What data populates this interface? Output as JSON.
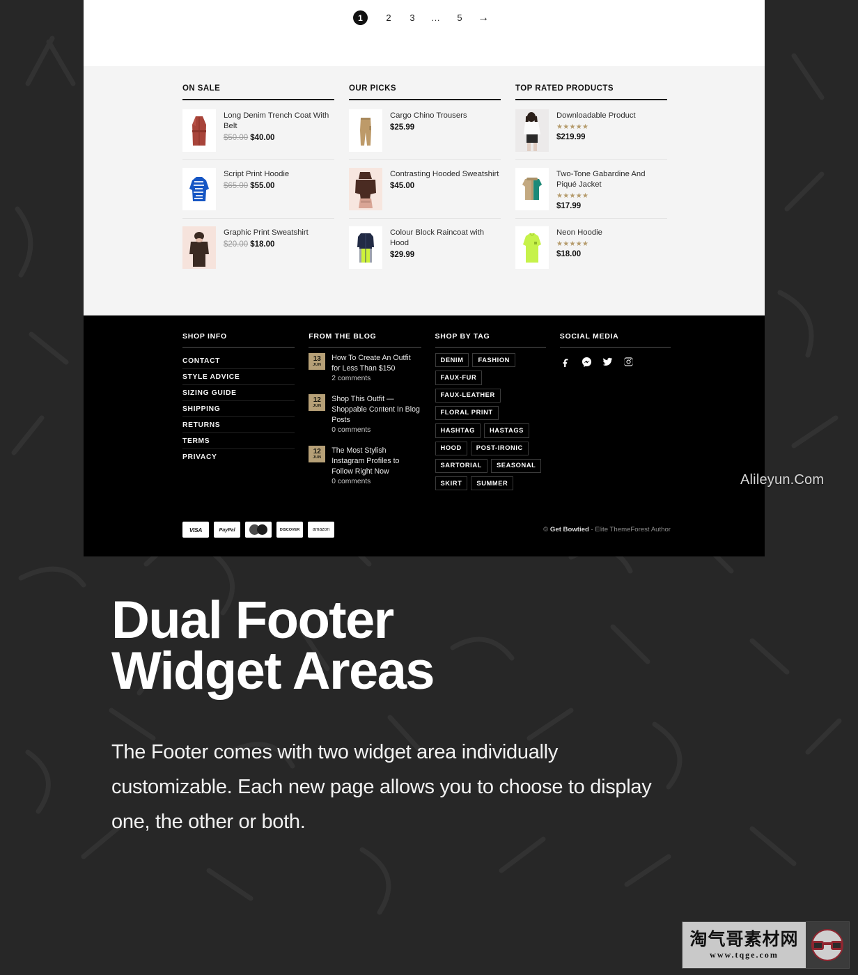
{
  "pagination": {
    "pages": [
      {
        "label": "1",
        "current": true
      },
      {
        "label": "2",
        "current": false
      },
      {
        "label": "3",
        "current": false
      },
      {
        "label": "…",
        "current": false
      },
      {
        "label": "5",
        "current": false
      }
    ],
    "next_label": "→"
  },
  "widgets": [
    {
      "title": "ON SALE",
      "type": "sale",
      "products": [
        {
          "name": "Long Denim Trench Coat With Belt",
          "old_price": "$50.00",
          "price": "$40.00",
          "image": "red-trench-coat"
        },
        {
          "name": "Script Print Hoodie",
          "old_price": "$65.00",
          "price": "$55.00",
          "image": "blue-script-hoodie"
        },
        {
          "name": "Graphic Print Sweatshirt",
          "old_price": "$20.00",
          "price": "$18.00",
          "image": "brown-sweatshirt"
        }
      ]
    },
    {
      "title": "OUR PICKS",
      "type": "picks",
      "products": [
        {
          "name": "Cargo Chino Trousers",
          "price": "$25.99",
          "image": "tan-cargo-trousers"
        },
        {
          "name": "Contrasting Hooded Sweatshirt",
          "price": "$45.00",
          "image": "brown-hooded-sweatshirt"
        },
        {
          "name": "Colour Block Raincoat with Hood",
          "price": "$29.99",
          "image": "colour-block-raincoat"
        }
      ]
    },
    {
      "title": "TOP RATED PRODUCTS",
      "type": "rated",
      "products": [
        {
          "name": "Downloadable Product",
          "rating": "★★★★★",
          "price": "$219.99",
          "image": "model-white-top"
        },
        {
          "name": "Two-Tone Gabardine And Piqué Jacket",
          "rating": "★★★★★",
          "price": "$17.99",
          "image": "two-tone-jacket"
        },
        {
          "name": "Neon Hoodie",
          "rating": "★★★★★",
          "price": "$18.00",
          "image": "neon-green-hoodie"
        }
      ]
    }
  ],
  "footer": {
    "shop_info": {
      "title": "SHOP INFO",
      "links": [
        "CONTACT",
        "STYLE ADVICE",
        "SIZING GUIDE",
        "SHIPPING",
        "RETURNS",
        "TERMS",
        "PRIVACY"
      ]
    },
    "blog": {
      "title": "FROM THE BLOG",
      "posts": [
        {
          "day": "13",
          "month": "JUN",
          "title": "How To Create An Outfit for Less Than $150",
          "comments": "2 comments"
        },
        {
          "day": "12",
          "month": "JUN",
          "title": "Shop This Outfit — Shoppable Content In Blog Posts",
          "comments": "0 comments"
        },
        {
          "day": "12",
          "month": "JUN",
          "title": "The Most Stylish Instagram Profiles to Follow Right Now",
          "comments": "0 comments"
        }
      ]
    },
    "tags": {
      "title": "SHOP BY TAG",
      "items": [
        "DENIM",
        "FASHION",
        "FAUX-FUR",
        "FAUX-LEATHER",
        "FLORAL PRINT",
        "HASHTAG",
        "HASTAGS",
        "HOOD",
        "POST-IRONIC",
        "SARTORIAL",
        "SEASONAL",
        "SKIRT",
        "SUMMER"
      ]
    },
    "social": {
      "title": "SOCIAL MEDIA",
      "networks": [
        "facebook-icon",
        "messenger-icon",
        "twitter-icon",
        "instagram-icon"
      ]
    },
    "payments": [
      {
        "name": "VISA",
        "key": "visa"
      },
      {
        "name": "PayPal",
        "key": "paypal"
      },
      {
        "name": "Mastercard",
        "key": "mastercard"
      },
      {
        "name": "DISCOVER",
        "key": "discover"
      },
      {
        "name": "amazon",
        "key": "amazon"
      }
    ],
    "copyright_prefix": "©",
    "copyright_brand": "Get Bowtied",
    "copyright_suffix": "- Elite ThemeForest Author"
  },
  "hero": {
    "heading_line1": "Dual Footer",
    "heading_line2": "Widget Areas",
    "paragraph": "The Footer comes with two widget area individually customizable. Each new page allows you to choose to display one, the other or both."
  },
  "watermarks": {
    "alileyun": "Alileyun.Com",
    "tqge_cn": "淘气哥素材网",
    "tqge_url": "www.tqge.com"
  },
  "colors": {
    "page_bg": "#272727",
    "widget_bg": "#f4f4f4",
    "footer_bg": "#000000",
    "star": "#b59b6c",
    "date_badge": "#b6a077"
  }
}
